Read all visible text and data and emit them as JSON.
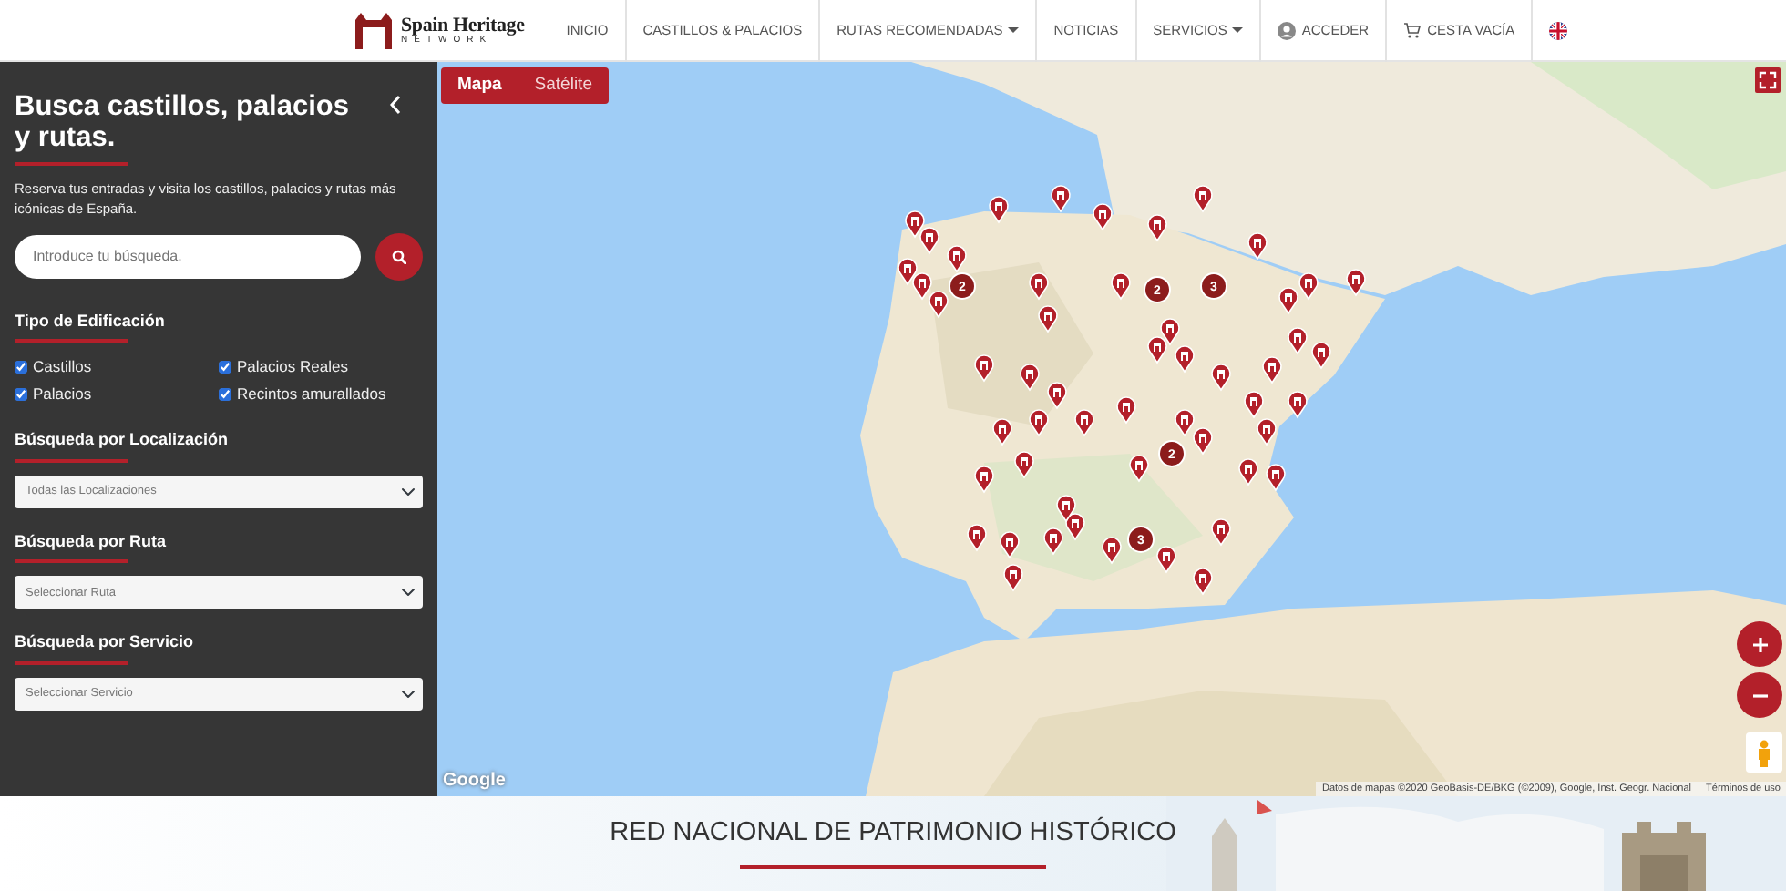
{
  "navbar": {
    "brand": {
      "name": "Spain Heritage",
      "tagline": "NETWORK"
    },
    "items": [
      {
        "label": "INICIO",
        "kind": "link"
      },
      {
        "label": "CASTILLOS & PALACIOS",
        "kind": "link"
      },
      {
        "label": "RUTAS RECOMENDADAS",
        "kind": "dropdown"
      },
      {
        "label": "NOTICIAS",
        "kind": "link"
      },
      {
        "label": "SERVICIOS",
        "kind": "dropdown"
      },
      {
        "label": "ACCEDER",
        "kind": "user"
      },
      {
        "label": "CESTA VACÍA",
        "kind": "cart"
      },
      {
        "kind": "flag"
      }
    ]
  },
  "sidebar": {
    "title": "Busca castillos, palacios y rutas.",
    "intro": "Reserva tus entradas y visita los castillos, palacios y rutas más icónicas de España.",
    "search": {
      "placeholder": "Introduce tu búsqueda."
    },
    "building_type": {
      "heading": "Tipo de Edificación",
      "options": [
        {
          "label": "Castillos",
          "checked": true
        },
        {
          "label": "Palacios Reales",
          "checked": true
        },
        {
          "label": "Palacios",
          "checked": true
        },
        {
          "label": "Recintos amurallados",
          "checked": true
        }
      ]
    },
    "selects": [
      {
        "heading": "Búsqueda por Localización",
        "value": "Todas las Localizaciones"
      },
      {
        "heading": "Búsqueda por Ruta",
        "value": "Seleccionar Ruta"
      },
      {
        "heading": "Búsqueda por Servicio",
        "value": "Seleccionar Servicio"
      }
    ]
  },
  "map": {
    "map_types": [
      {
        "label": "Mapa",
        "selected": true
      },
      {
        "label": "Satélite",
        "selected": false
      }
    ],
    "clusters": [
      "2",
      "2",
      "3",
      "2",
      "3"
    ],
    "google_logo": "Google",
    "attribution": "Datos de mapas ©2020 GeoBasis-DE/BKG (©2009), Google, Inst. Geogr. Nacional",
    "terms": "Términos de uso"
  },
  "section": {
    "heading": "RED NACIONAL DE PATRIMONIO HISTÓRICO"
  }
}
